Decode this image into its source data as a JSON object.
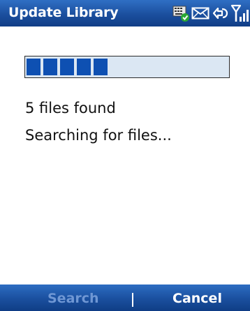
{
  "titlebar": {
    "title": "Update Library",
    "status_icons": [
      "keyboard-check-icon",
      "envelope-icon",
      "sync-icon",
      "signal-icon"
    ]
  },
  "progress": {
    "fraction": 0.4
  },
  "content": {
    "files_found": "5 files found",
    "status": "Searching for files..."
  },
  "softkeys": {
    "left": "Search",
    "right": "Cancel",
    "left_enabled": false
  },
  "colors": {
    "bar_blue": "#1b4f9e",
    "progress_fill": "#0e50b2",
    "progress_bg": "#dbe7f3",
    "disabled_text": "#6f97d4"
  }
}
